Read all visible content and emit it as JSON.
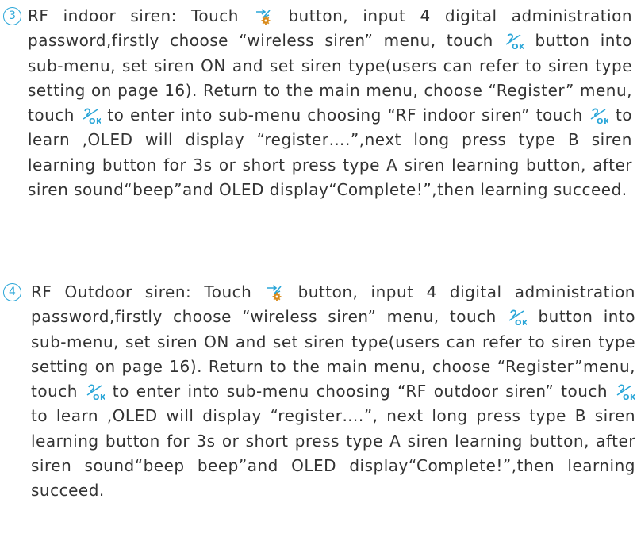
{
  "items": [
    {
      "marker": "3",
      "segments": [
        "RF indoor siren: Touch",
        "button, input 4 digital administration password,firstly choose “wireless siren” menu, touch",
        "button into sub-menu, set siren ON and set siren type(users can refer to siren type setting on page 16). Return to the main menu, choose “Register” menu, touch",
        "to enter into sub-menu choosing “RF indoor siren” touch",
        "to learn ,OLED will display “register….”,next long press type B siren learning button for 3s or short press type A siren learning button, after siren sound“beep”and OLED display“Complete!”,then learning succeed."
      ]
    },
    {
      "marker": "4",
      "segments": [
        "RF Outdoor siren: Touch",
        "button, input 4 digital administration password,firstly choose “wireless siren” menu, touch",
        "button into sub-menu, set siren ON and set siren type(users can refer to siren type setting on page 16). Return to the main menu, choose “Register”menu, touch",
        "to enter into sub-menu choosing “RF outdoor siren” touch",
        "to learn ,OLED will display “register….”, next long press type B siren learning button for 3s or short press type A siren learning button, after siren sound“beep beep”and OLED display“Complete!”,then learning succeed."
      ]
    }
  ],
  "icons": {
    "settings": "settings-icon",
    "ok": "ok-icon",
    "ok_label": "OK"
  },
  "colors": {
    "accent": "#2aa6d8",
    "text": "#333333"
  }
}
